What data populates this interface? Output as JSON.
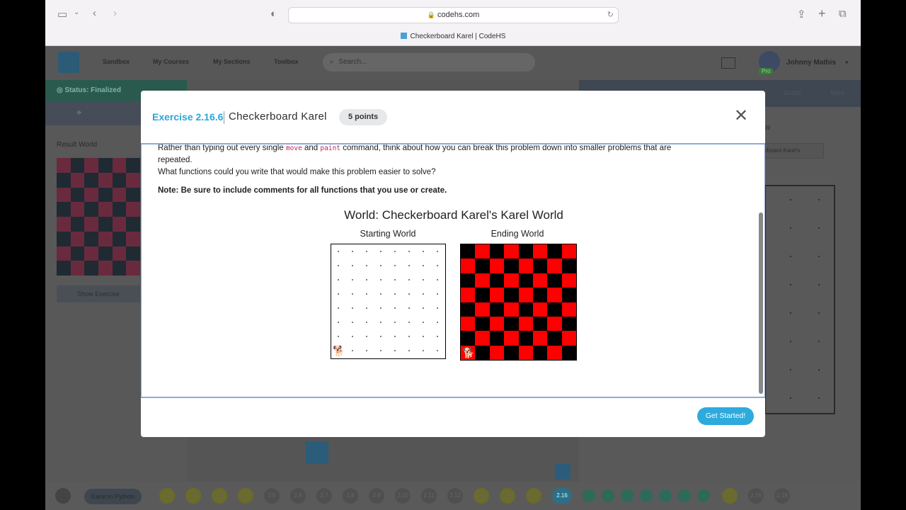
{
  "browser": {
    "url": "codehs.com",
    "tab_title": "Checkerboard Karel | CodeHS"
  },
  "nav": {
    "links": [
      "Sandbox",
      "My Courses",
      "My Sections",
      "Toolbox"
    ],
    "search_placeholder": "Search...",
    "user_name": "Johnny Mathis",
    "user_badge": "Pro"
  },
  "left_panel": {
    "status": "Status: Finalized",
    "result_label": "Result World",
    "show_exercise": "Show Exercise"
  },
  "right_panel": {
    "tabs": [
      "Grade",
      "More"
    ],
    "world_select": "rboard Karel's"
  },
  "modal": {
    "exercise_number": "Exercise 2.16.6",
    "title": "Checkerboard Karel",
    "points": "5 points",
    "close_icon": "close-icon",
    "para1_a": "Rather than typing out every single",
    "para1_cmd1": "move",
    "para1_b": "and",
    "para1_cmd2": "paint",
    "para1_c": "command, think about how you can break this problem down into smaller problems that are",
    "para1_d": "repeated.",
    "para2": "What functions could you write that would make this problem easier to solve?",
    "note": "Note: Be sure to include comments for all functions that you use or create.",
    "world_title": "World: Checkerboard Karel's Karel World",
    "starting_label": "Starting World",
    "ending_label": "Ending World",
    "get_started": "Get Started!"
  },
  "bottom_bar": {
    "crumb": "Karel in Python",
    "lessons": [
      "2.1",
      "2.2",
      "2.3",
      "2.4",
      "2.5",
      "2.6",
      "2.7",
      "2.8",
      "2.9",
      "2.10",
      "2.11",
      "2.12",
      "2.13",
      "2.14",
      "2.15",
      "2.16"
    ],
    "after": [
      "2.17",
      "2.18",
      "2.19"
    ]
  },
  "colors": {
    "accent": "#2eaadc",
    "red": "#ff0000",
    "black": "#000000"
  }
}
